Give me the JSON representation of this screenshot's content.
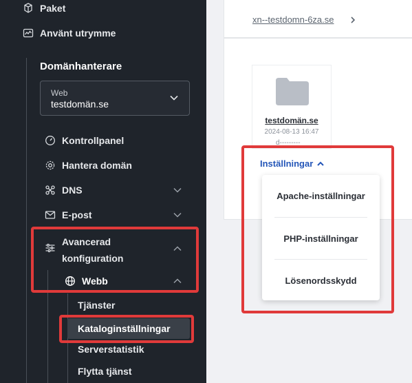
{
  "sidebar": {
    "top_items": [
      {
        "label": "Paket",
        "icon": "package-icon"
      },
      {
        "label": "Använt utrymme",
        "icon": "storage-icon"
      }
    ],
    "section_title": "Domänhanterare",
    "domain_select": {
      "type_label": "Web",
      "value": "testdomän.se"
    },
    "nav": {
      "kontrollpanel": "Kontrollpanel",
      "hantera_doman": "Hantera domän",
      "dns": "DNS",
      "epost": "E-post",
      "avancerad_line1": "Avancerad",
      "avancerad_line2": "konfiguration",
      "webb": "Webb",
      "tjanster": "Tjänster",
      "kataloginstallningar": "Kataloginställningar",
      "serverstatistik": "Serverstatistik",
      "flytta_tjanst": "Flytta tjänst"
    }
  },
  "main": {
    "breadcrumb": "xn--testdomn-6za.se",
    "folder": {
      "name": "testdomän.se",
      "date": "2024-08-13 16:47",
      "perms": "d---------"
    },
    "settings_button": "Inställningar",
    "dropdown": [
      "Apache-inställningar",
      "PHP-inställningar",
      "Lösenordsskydd"
    ]
  },
  "colors": {
    "sidebar_bg": "#1f242b",
    "highlight": "#e03a3a",
    "link": "#2456b8",
    "active_item_bg": "#3a4048"
  }
}
